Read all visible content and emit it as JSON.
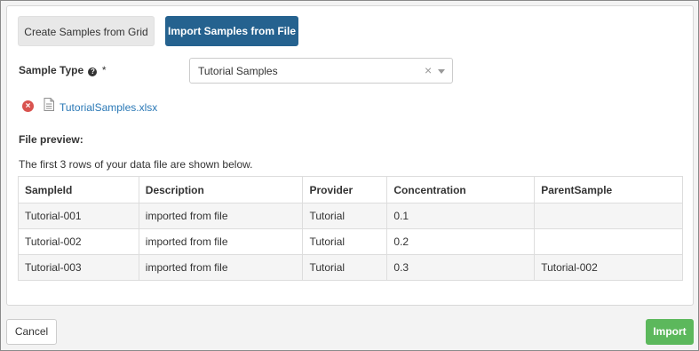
{
  "tabs": {
    "grid_label": "Create Samples from Grid",
    "file_label": "Import Samples from File"
  },
  "sample_type": {
    "label": "Sample Type",
    "required_mark": "*",
    "help_glyph": "?",
    "value": "Tutorial Samples",
    "clear_glyph": "×"
  },
  "file": {
    "name": "TutorialSamples.xlsx",
    "remove_glyph": "×"
  },
  "preview": {
    "title": "File preview:",
    "note": "The first 3 rows of your data file are shown below.",
    "columns": [
      "SampleId",
      "Description",
      "Provider",
      "Concentration",
      "ParentSample"
    ],
    "rows": [
      [
        "Tutorial-001",
        "imported from file",
        "Tutorial",
        "0.1",
        ""
      ],
      [
        "Tutorial-002",
        "imported from file",
        "Tutorial",
        "0.2",
        ""
      ],
      [
        "Tutorial-003",
        "imported from file",
        "Tutorial",
        "0.3",
        "Tutorial-002"
      ]
    ]
  },
  "footer": {
    "cancel_label": "Cancel",
    "import_label": "Import"
  },
  "colors": {
    "active_tab": "#25628f",
    "import_button": "#5cb85c",
    "remove_icon": "#d9534f",
    "link": "#2a78b6"
  },
  "icons": {
    "help": "question-circle-icon",
    "remove": "times-circle-icon",
    "file": "file-text-icon",
    "dropdown": "caret-down-icon",
    "clear": "clear-x-icon"
  }
}
